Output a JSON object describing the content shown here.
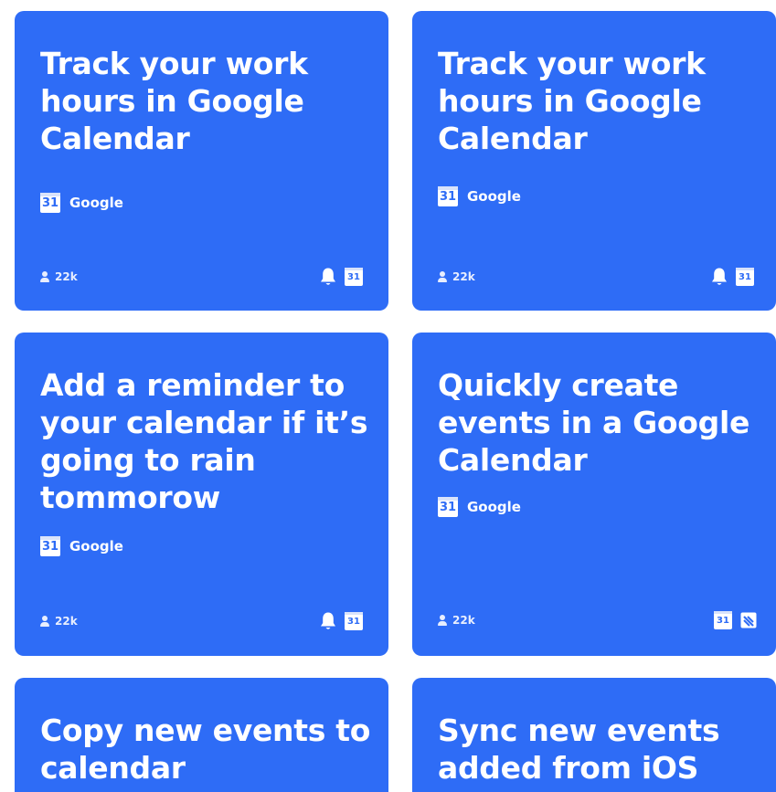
{
  "colors": {
    "card_background": "#2e6cf6",
    "page_background": "#ffffff",
    "text": "#ffffff"
  },
  "cards": [
    {
      "title": "Track your work hours in Google Calendar",
      "service_name": "Google",
      "service_icon": "google-calendar-icon",
      "service_icon_text": "31",
      "users": "22k",
      "footer_icons": [
        "bell-icon",
        "google-calendar-icon"
      ],
      "footer_icon_text": "31"
    },
    {
      "title": "Track your work hours in Google Calendar",
      "service_name": "Google",
      "service_icon": "google-calendar-icon",
      "service_icon_text": "31",
      "users": "22k",
      "footer_icons": [
        "bell-icon",
        "google-calendar-icon"
      ],
      "footer_icon_text": "31"
    },
    {
      "title": "Add a reminder to your calendar if it’s going to rain tommorow",
      "service_name": "Google",
      "service_icon": "google-calendar-icon",
      "service_icon_text": "31",
      "users": "22k",
      "footer_icons": [
        "bell-icon",
        "google-calendar-icon"
      ],
      "footer_icon_text": "31"
    },
    {
      "title": "Quickly create events in a Google Calendar",
      "service_name": "Google",
      "service_icon": "google-calendar-icon",
      "service_icon_text": "31",
      "users": "22k",
      "footer_icons": [
        "google-calendar-icon",
        "notes-icon"
      ],
      "footer_icon_text": "31"
    },
    {
      "title": "Copy new events to calendar"
    },
    {
      "title": "Sync new events added from iOS"
    }
  ]
}
